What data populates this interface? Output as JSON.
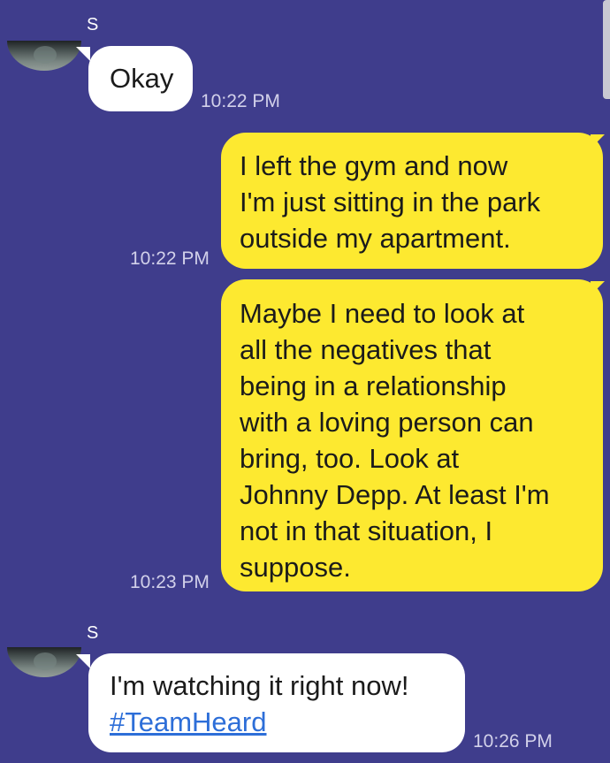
{
  "chat": {
    "messages": [
      {
        "sender": "S",
        "text": "Okay",
        "time": "10:22 PM"
      },
      {
        "lines": [
          "I left the gym and now",
          "I'm just sitting in the park",
          "outside my apartment."
        ],
        "time": "10:22 PM"
      },
      {
        "lines": [
          "Maybe I need to look at",
          "all the negatives that",
          "being in a relationship",
          "with a loving person can",
          "bring, too. Look at",
          "Johnny Depp. At least I'm",
          "not in that situation, I",
          "suppose."
        ],
        "time": "10:23 PM"
      },
      {
        "sender": "S",
        "text": "I'm watching it right now!",
        "hashtag": "#TeamHeard",
        "time": "10:26 PM"
      }
    ]
  },
  "colors": {
    "background": "#3f3d8c",
    "incoming_bubble": "#ffffff",
    "outgoing_bubble": "#fde930",
    "timestamp": "#d2d1ea",
    "hashtag": "#2d6ed8"
  }
}
